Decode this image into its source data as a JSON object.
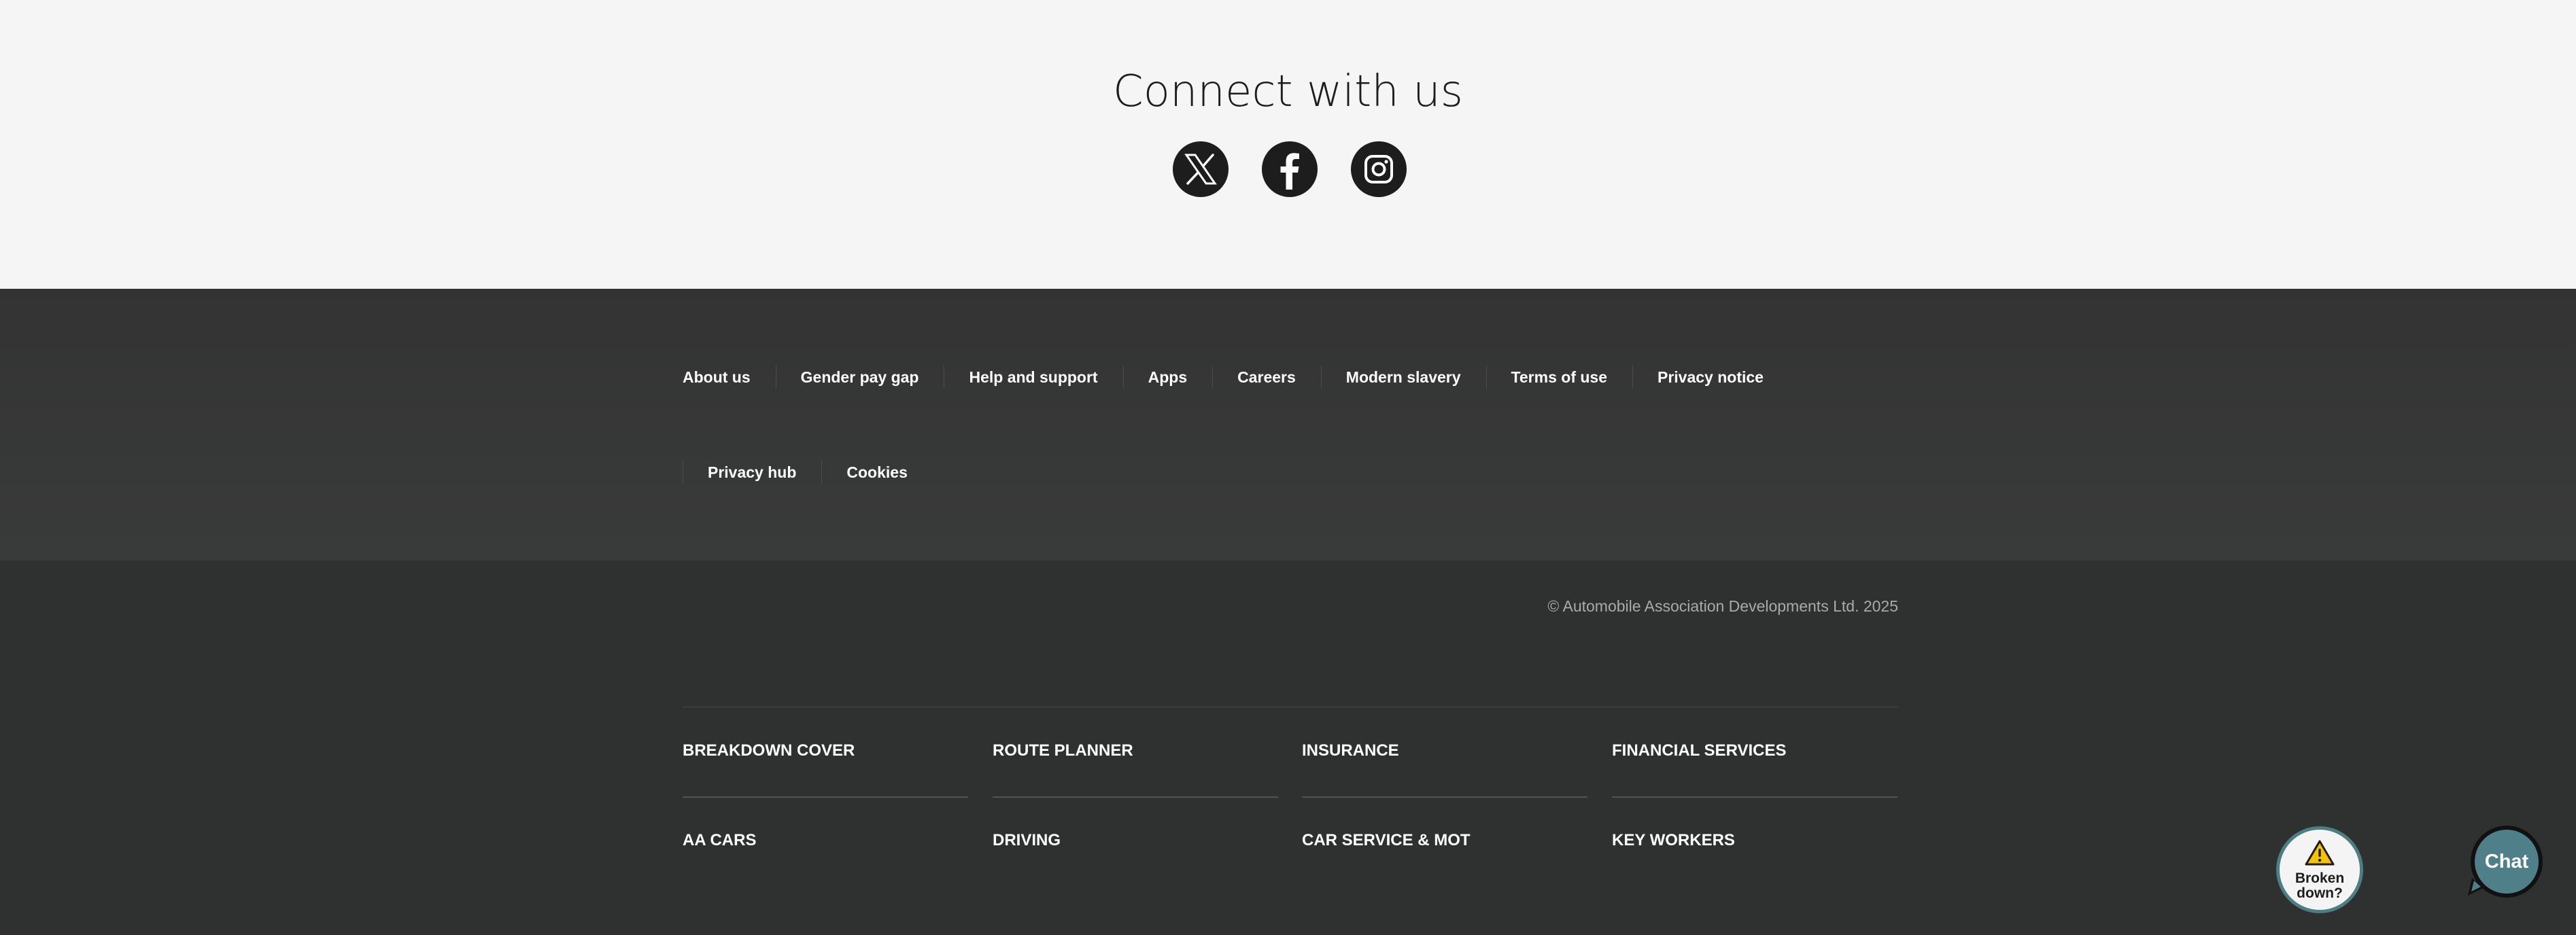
{
  "connect": {
    "title": "Connect with us",
    "social": [
      {
        "name": "x-icon"
      },
      {
        "name": "facebook-icon"
      },
      {
        "name": "instagram-icon"
      }
    ]
  },
  "footer_links": {
    "row1": [
      "About us",
      "Gender pay gap",
      "Help and support",
      "Apps",
      "Careers",
      "Modern slavery",
      "Terms of use",
      "Privacy notice"
    ],
    "row2": [
      "Privacy hub",
      "Cookies"
    ]
  },
  "copyright": "© Automobile Association Developments Ltd. 2025",
  "categories": [
    [
      "BREAKDOWN COVER",
      "ROUTE PLANNER",
      "INSURANCE",
      "FINANCIAL SERVICES"
    ],
    [
      "AA CARS",
      "DRIVING",
      "CAR SERVICE & MOT",
      "KEY WORKERS"
    ]
  ],
  "floating": {
    "broken_down_label": "Broken down?",
    "chat_label": "Chat"
  },
  "colors": {
    "connect_bg": "#f5f5f5",
    "footer_bg": "#2f3130",
    "links_bg": "#363837",
    "accent_teal": "#4f7f88",
    "warning_yellow": "#f6c200"
  }
}
